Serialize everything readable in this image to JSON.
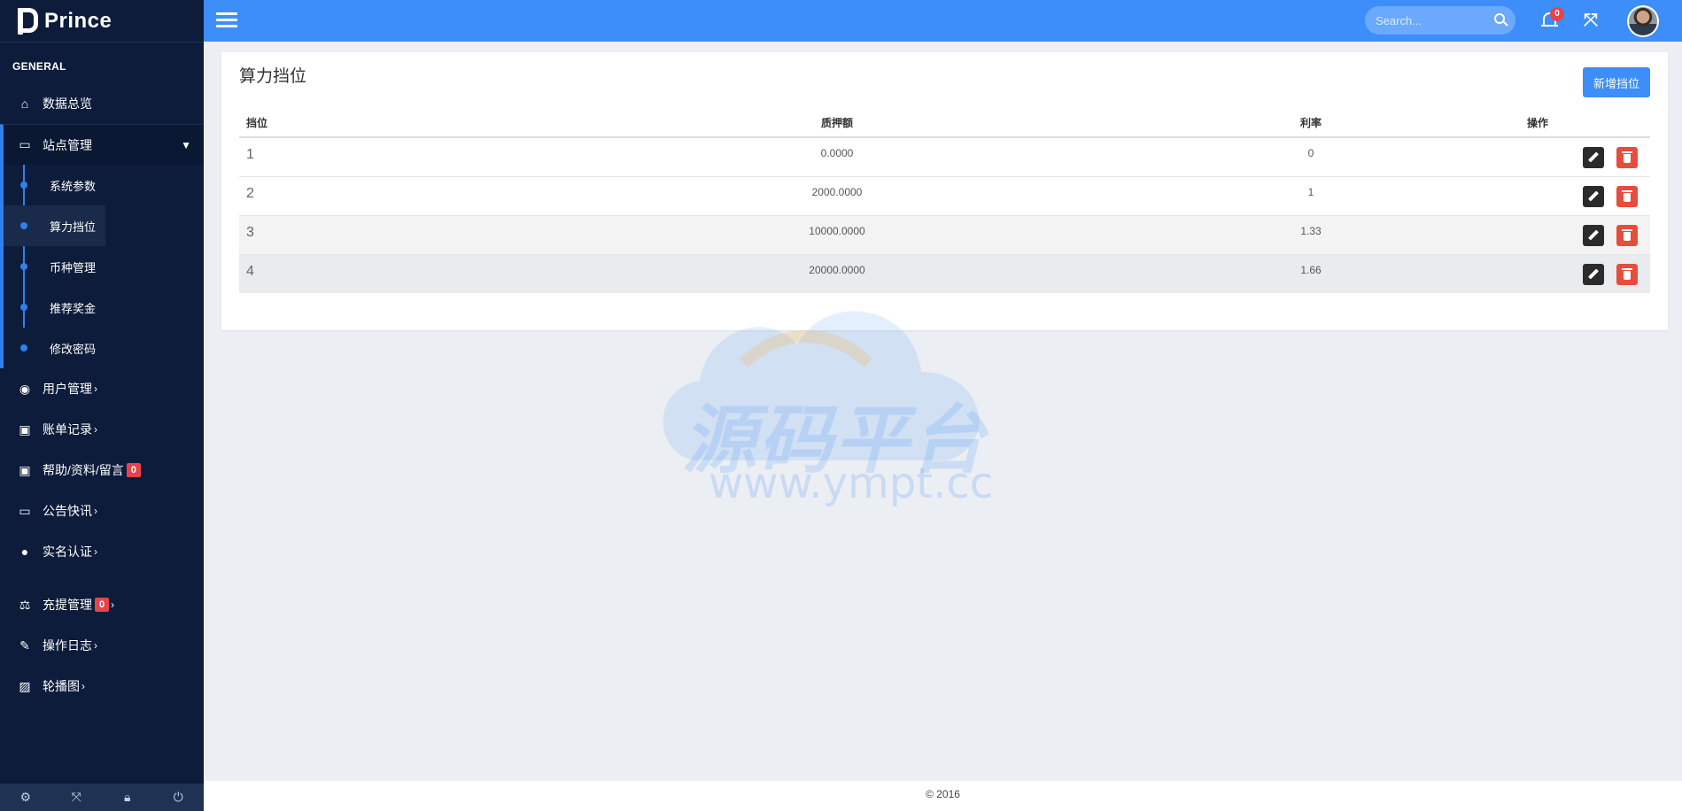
{
  "brand": {
    "name": "Prince"
  },
  "sidebar": {
    "section_title": "GENERAL",
    "items": [
      {
        "label": "数据总览",
        "icon": "home-icon"
      },
      {
        "label": "站点管理",
        "icon": "monitor-icon",
        "open": true
      },
      {
        "label": "用户管理",
        "icon": "user-circle-icon"
      },
      {
        "label": "账单记录",
        "icon": "money-icon"
      },
      {
        "label": "帮助/资料/留言",
        "icon": "money-icon",
        "badge": "0"
      },
      {
        "label": "公告快讯",
        "icon": "window-icon"
      },
      {
        "label": "实名认证",
        "icon": "user-icon"
      },
      {
        "label": "充提管理",
        "icon": "balance-scale-icon",
        "badge": "0"
      },
      {
        "label": "操作日志",
        "icon": "edit-icon"
      },
      {
        "label": "轮播图",
        "icon": "image-icon"
      }
    ],
    "submenu": [
      {
        "label": "系统参数"
      },
      {
        "label": "算力挡位",
        "active": true
      },
      {
        "label": "币种管理"
      },
      {
        "label": "推荐奖金"
      },
      {
        "label": "修改密码"
      }
    ],
    "footer_icons": [
      "gear-icon",
      "fullscreen-icon",
      "lock-icon",
      "power-icon"
    ]
  },
  "topbar": {
    "search_placeholder": "Search...",
    "notification_count": "0"
  },
  "main": {
    "title": "算力挡位",
    "add_button": "新增挡位",
    "table": {
      "headers": [
        "挡位",
        "质押额",
        "利率",
        "操作"
      ],
      "rows": [
        {
          "level": "1",
          "amount": "0.0000",
          "rate": "0"
        },
        {
          "level": "2",
          "amount": "2000.0000",
          "rate": "1"
        },
        {
          "level": "3",
          "amount": "10000.0000",
          "rate": "1.33"
        },
        {
          "level": "4",
          "amount": "20000.0000",
          "rate": "1.66"
        }
      ]
    }
  },
  "watermark": {
    "text": "源码平台",
    "url": "www.ympt.cc"
  },
  "footer": {
    "copyright": "© 2016"
  },
  "colors": {
    "sidebar": "#0d1c3b",
    "accent": "#3d8ef8",
    "danger": "#e74c3c",
    "badge": "#e8434a"
  }
}
